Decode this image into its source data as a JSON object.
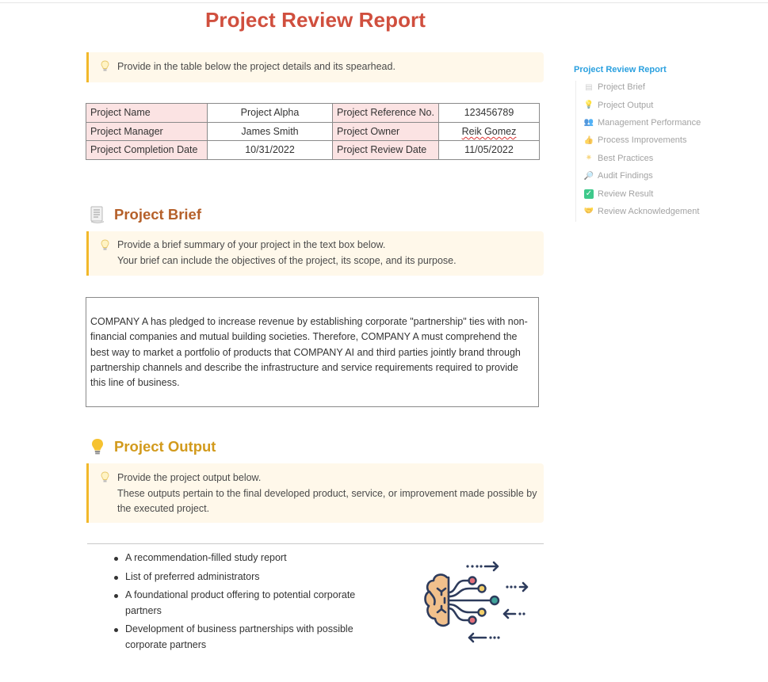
{
  "document": {
    "title": "Project Review Report"
  },
  "details_callout": {
    "lines": [
      "Provide in the table below the project details and its spearhead."
    ]
  },
  "details_table": {
    "rows": [
      [
        {
          "label": "Project Name",
          "value": "Project Alpha"
        },
        {
          "label": "Project Reference No.",
          "value": "123456789"
        }
      ],
      [
        {
          "label": "Project Manager",
          "value": "James Smith"
        },
        {
          "label": "Project Owner",
          "value": "Reik Gomez"
        }
      ],
      [
        {
          "label": "Project Completion Date",
          "value": "10/31/2022"
        },
        {
          "label": "Project Review Date",
          "value": "11/05/2022"
        }
      ]
    ]
  },
  "brief": {
    "heading": "Project Brief",
    "icon": "page-icon",
    "callout_lines": [
      "Provide a brief summary of your project in the text box below.",
      "Your brief can include the objectives of the project, its scope, and its purpose."
    ],
    "body": "COMPANY A has pledged to increase revenue by establishing corporate \"partnership\" ties with non-financial companies and mutual building societies. Therefore, COMPANY A must comprehend the best way to market a portfolio of products that COMPANY AI and third parties jointly brand through partnership channels and describe the infrastructure and service requirements required to provide this line of business."
  },
  "output": {
    "heading": "Project Output",
    "icon": "lightbulb-icon",
    "callout_lines": [
      "Provide the project output below.",
      "These outputs pertain to the final developed product, service, or improvement made possible by the executed project."
    ],
    "items": [
      "A recommendation-filled study report",
      "List of preferred administrators",
      "A foundational product offering to potential corporate partners",
      "Development of business partnerships with possible corporate partners"
    ],
    "illustration": "brain-network-icon"
  },
  "toc": {
    "title": "Project Review Report",
    "items": [
      {
        "label": "Project Brief",
        "icon": "page-icon",
        "glyph": "▤",
        "color": "#cfcfcf"
      },
      {
        "label": "Project Output",
        "icon": "lightbulb-icon",
        "glyph": "💡",
        "color": "#f5c542"
      },
      {
        "label": "Management Performance",
        "icon": "people-icon",
        "glyph": "👥",
        "color": "#6a6f8a"
      },
      {
        "label": "Process Improvements",
        "icon": "thumbs-up-icon",
        "glyph": "👍",
        "color": "#f2b23a"
      },
      {
        "label": "Best Practices",
        "icon": "sparkle-icon",
        "glyph": "✷",
        "color": "#f6cc5c"
      },
      {
        "label": "Audit Findings",
        "icon": "magnifier-icon",
        "glyph": "🔎",
        "color": "#3c88c9"
      },
      {
        "label": "Review Result",
        "icon": "check-box-icon",
        "glyph": "✓",
        "color": "#3ec98b"
      },
      {
        "label": "Review Acknowledgement",
        "icon": "handshake-icon",
        "glyph": "🤝",
        "color": "#f2b23a"
      }
    ]
  },
  "colors": {
    "title": "#d04f3e",
    "brief_heading": "#b5602a",
    "output_heading": "#d29a1c",
    "callout_bg": "#fff8ea",
    "callout_border": "#f2b82a",
    "table_label_bg": "#fbe3e3",
    "toc_title": "#2aa0df"
  }
}
